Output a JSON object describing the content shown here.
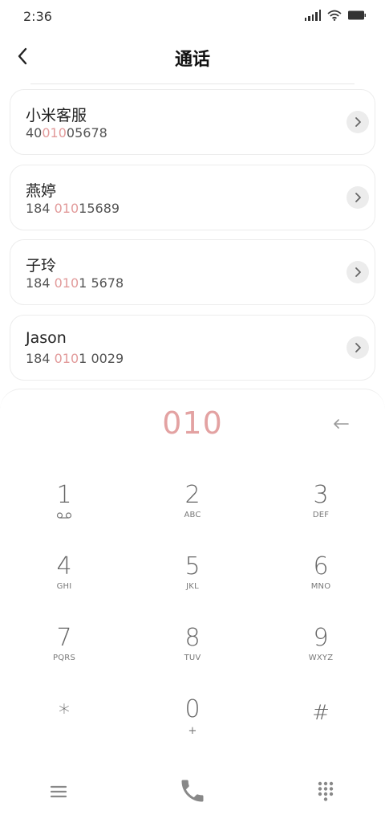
{
  "status_bar": {
    "time": "2:36",
    "icons": [
      "signal-icon",
      "wifi-icon",
      "battery-icon"
    ]
  },
  "header": {
    "back_icon": "chevron-left-icon",
    "title": "通话"
  },
  "contacts": [
    {
      "name": "小米客服",
      "number_pre": "40",
      "number_match": "010",
      "number_post": "05678"
    },
    {
      "name": "燕婷",
      "number_pre": "184 ",
      "number_match": "010",
      "number_post": "15689"
    },
    {
      "name": "子玲",
      "number_pre": "184 ",
      "number_match": "010",
      "number_post": "1 5678"
    },
    {
      "name": "Jason",
      "number_pre": "184 ",
      "number_match": "010",
      "number_post": "1 0029"
    }
  ],
  "dialer": {
    "entered_number": "010",
    "keys": [
      {
        "digit": "1",
        "letters": "",
        "icon": "voicemail-icon"
      },
      {
        "digit": "2",
        "letters": "ABC"
      },
      {
        "digit": "3",
        "letters": "DEF"
      },
      {
        "digit": "4",
        "letters": "GHI"
      },
      {
        "digit": "5",
        "letters": "JKL"
      },
      {
        "digit": "6",
        "letters": "MNO"
      },
      {
        "digit": "7",
        "letters": "PQRS"
      },
      {
        "digit": "8",
        "letters": "TUV"
      },
      {
        "digit": "9",
        "letters": "WXYZ"
      },
      {
        "digit": "*",
        "letters": ""
      },
      {
        "digit": "0",
        "letters": "+"
      },
      {
        "digit": "#",
        "letters": ""
      }
    ]
  },
  "bottom_bar": {
    "icons": [
      "menu-icon",
      "phone-icon",
      "dialpad-icon"
    ]
  },
  "colors": {
    "match_highlight": "#e29b9b",
    "dial_number": "#e3a2a2",
    "card_border": "#ececec"
  }
}
